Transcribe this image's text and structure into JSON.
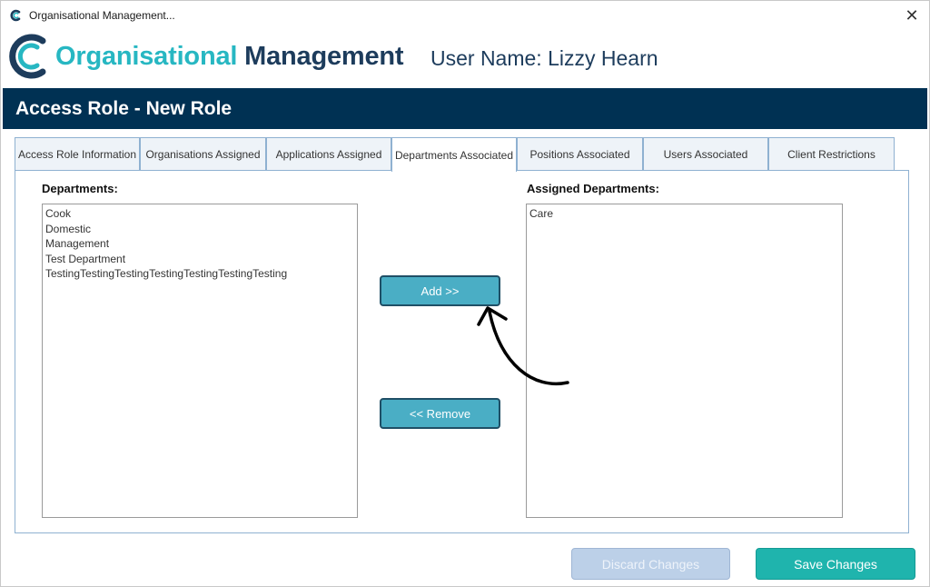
{
  "window": {
    "title": "Organisational Management...",
    "close_label": "✕"
  },
  "brand": {
    "part1": "Organisational ",
    "part2": "Management",
    "user_name": "User Name: Lizzy Hearn"
  },
  "banner": {
    "title": "Access Role - New Role"
  },
  "tabs": [
    {
      "label": "Access Role Information",
      "active": false
    },
    {
      "label": "Organisations Assigned",
      "active": false
    },
    {
      "label": "Applications Assigned",
      "active": false
    },
    {
      "label": "Departments Associated",
      "active": true
    },
    {
      "label": "Positions Associated",
      "active": false
    },
    {
      "label": "Users Associated",
      "active": false
    },
    {
      "label": "Client Restrictions",
      "active": false
    }
  ],
  "departments": {
    "label": "Departments:",
    "items": [
      "Cook",
      "Domestic",
      "Management",
      "Test Department",
      "TestingTestingTestingTestingTestingTestingTesting"
    ]
  },
  "assigned": {
    "label": "Assigned Departments:",
    "items": [
      "Care"
    ]
  },
  "buttons": {
    "add": "Add  >>",
    "remove": "<< Remove",
    "discard": "Discard Changes",
    "save": "Save Changes"
  },
  "colors": {
    "brand_teal": "#27b7c2",
    "brand_navy": "#1d3c5c",
    "banner": "#003153",
    "move_button": "#4aaec5",
    "save_button": "#1fb4ad",
    "discard_button": "#bcd0e8"
  },
  "icons": {
    "app": "c-logo-icon",
    "close": "close-icon",
    "annotation": "curved-arrow-icon"
  }
}
